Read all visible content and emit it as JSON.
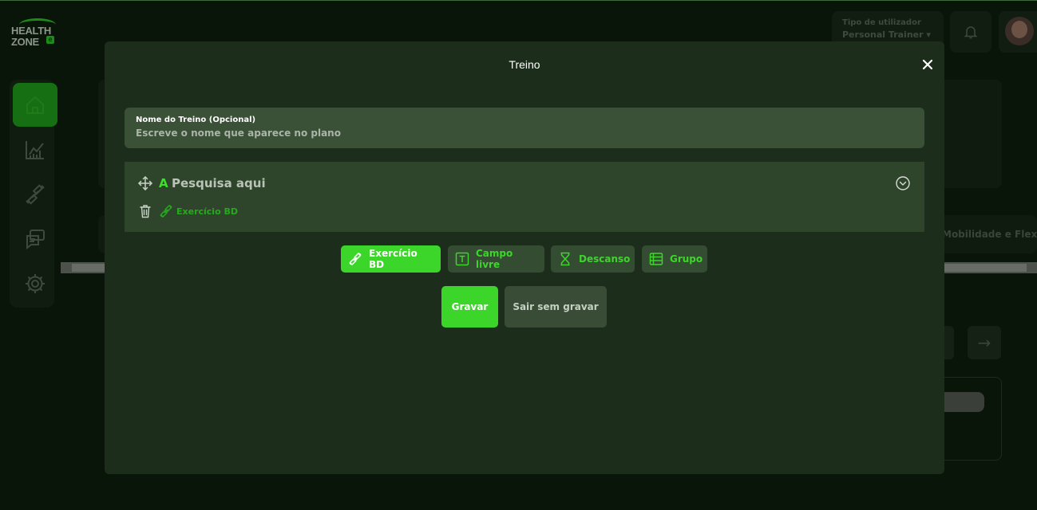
{
  "app": {
    "logo_line1": "HEALTH",
    "logo_line2": "ZONE",
    "logo_badge": "e"
  },
  "header": {
    "user_type_label": "Tipo de utilizador",
    "user_type_value": "Personal Trainer ▾"
  },
  "sidebar": {
    "items": [
      {
        "icon": "home-icon",
        "active": true
      },
      {
        "icon": "chart-icon",
        "active": false
      },
      {
        "icon": "dumbbell-icon",
        "active": false
      },
      {
        "icon": "chat-icon",
        "active": false
      },
      {
        "icon": "gear-icon",
        "active": false
      }
    ]
  },
  "background": {
    "mobility_text": "Mobilidade e Flexibili",
    "arrow": "→"
  },
  "modal": {
    "title": "Treino",
    "name_field": {
      "label": "Nome do Treino (Opcional)",
      "placeholder": "Escreve o nome que aparece no plano",
      "value": ""
    },
    "exercise": {
      "letter": "A",
      "search_text": "Pesquisa aqui",
      "tag_label": "Exercício BD"
    },
    "add_buttons": [
      {
        "label": "Exercício BD",
        "icon": "dumbbell-icon",
        "active": true
      },
      {
        "label": "Campo livre",
        "icon": "text-icon",
        "active": false
      },
      {
        "label": "Descanso",
        "icon": "hourglass-icon",
        "active": false
      },
      {
        "label": "Grupo",
        "icon": "group-icon",
        "active": false
      }
    ],
    "save_label": "Gravar",
    "exit_label": "Sair sem gravar"
  },
  "colors": {
    "accent": "#3cd62b",
    "modal_bg": "#1c2e1b",
    "page_bg": "#0a1509"
  }
}
